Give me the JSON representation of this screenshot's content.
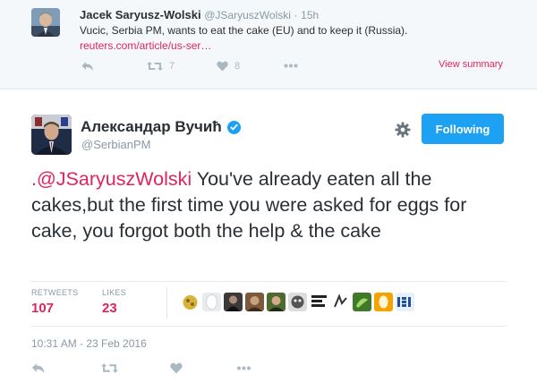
{
  "parent_tweet": {
    "name": "Jacek Saryusz-Wolski",
    "handle": "@JSaryuszWolski",
    "separator": "·",
    "time": "15h",
    "text": "Vucic, Serbia PM, wants to eat the cake (EU) and to keep it (Russia).",
    "link": "reuters.com/article/us-ser…",
    "retweet_count": "7",
    "like_count": "8",
    "view_summary": "View summary"
  },
  "main_tweet": {
    "name": "Александар Вучић",
    "handle": "@SerbianPM",
    "follow_label": "Following",
    "mention": ".@JSaryuszWolski",
    "text": " You've already eaten all the cakes,but the first time you were asked for eggs for cake, you forgot both the help & the cake",
    "retweets_label": "RETWEETS",
    "retweets_value": "107",
    "likes_label": "LIKES",
    "likes_value": "23",
    "timestamp": "10:31 AM - 23 Feb 2016"
  },
  "colors": {
    "accent_pink": "#e0245e",
    "follow_blue": "#1da1f2",
    "muted_gray": "#8899a6",
    "action_gray": "#aab8c2"
  },
  "icons": [
    "reply-icon",
    "retweet-icon",
    "like-icon",
    "more-icon",
    "gear-icon",
    "verified-icon"
  ]
}
